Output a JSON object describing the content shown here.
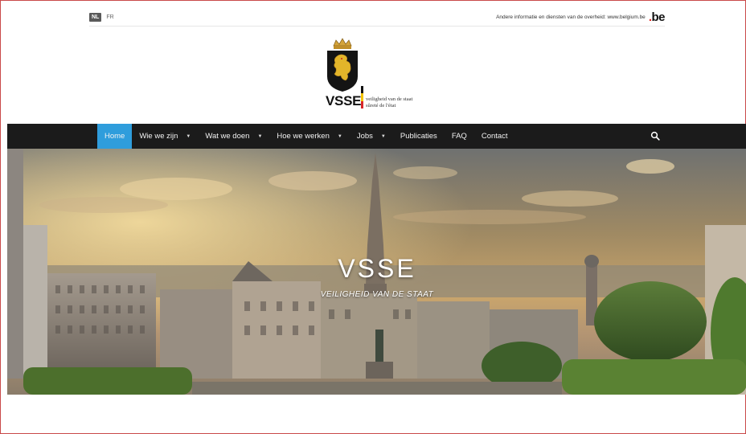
{
  "topbar": {
    "lang_active": "NL",
    "lang_other": "FR",
    "gov_text": "Andere informatie en diensten van de overheid: www.belgium.be",
    "be_logo": "be"
  },
  "logo": {
    "name": "VSSE",
    "sub_line1": "veiligheid van de staat",
    "sub_line2": "sûreté de l'état"
  },
  "nav": {
    "items": [
      {
        "label": "Home",
        "active": true,
        "dropdown": false
      },
      {
        "label": "Wie we zijn",
        "active": false,
        "dropdown": true
      },
      {
        "label": "Wat we doen",
        "active": false,
        "dropdown": true
      },
      {
        "label": "Hoe we werken",
        "active": false,
        "dropdown": true
      },
      {
        "label": "Jobs",
        "active": false,
        "dropdown": true
      },
      {
        "label": "Publicaties",
        "active": false,
        "dropdown": false
      },
      {
        "label": "FAQ",
        "active": false,
        "dropdown": false
      },
      {
        "label": "Contact",
        "active": false,
        "dropdown": false
      }
    ],
    "search_icon": "search-icon"
  },
  "hero": {
    "title": "VSSE",
    "subtitle": "VEILIGHEID VAN DE STAAT"
  },
  "colors": {
    "nav_bg": "#1b1b1b",
    "nav_active": "#2f9ddc",
    "be_red": "#e5312b",
    "flag_black": "#111111",
    "flag_yellow": "#f4c300",
    "flag_red": "#d8262b"
  }
}
